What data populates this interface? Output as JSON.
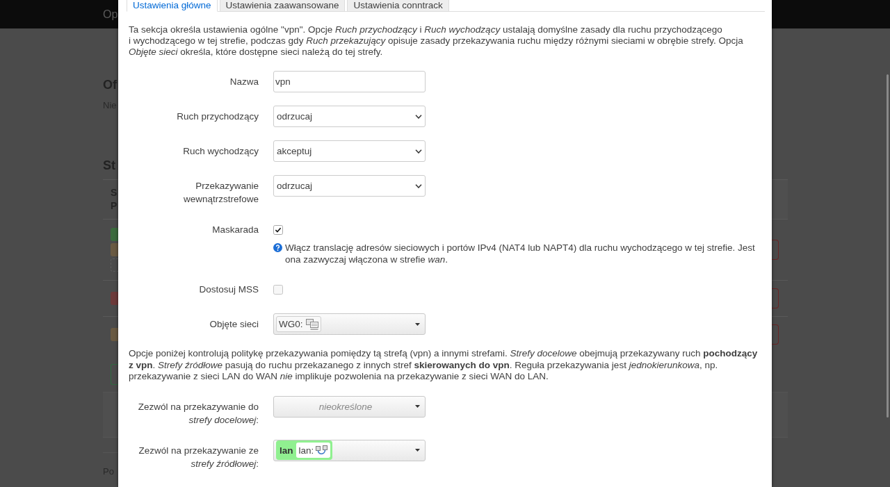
{
  "background_page": {
    "header_title": "Op",
    "heading": "Of",
    "subtitle": "Nie",
    "section_heading": "St",
    "table": {
      "header": [
        "S",
        "P"
      ],
      "rows": [
        {
          "badges": [
            {
              "kind": "solid",
              "color": "#3b6a3d"
            },
            {
              "kind": "solid",
              "color": "#6a5a42"
            },
            {
              "kind": "dashed",
              "color": "#5e5e5e"
            }
          ]
        },
        {
          "badges": [
            {
              "kind": "solid",
              "color": "#6d3a3a"
            }
          ]
        },
        {
          "badges": [
            {
              "kind": "solid",
              "color": "#6a5a42"
            }
          ]
        }
      ]
    },
    "footer_text": "Po"
  },
  "modal": {
    "tabs": [
      {
        "label": "Ustawienia główne",
        "selected": true
      },
      {
        "label": "Ustawienia zaawansowane",
        "selected": false
      },
      {
        "label": "Ustawienia conntrack",
        "selected": false
      }
    ],
    "intro": "Ta sekcja określa ustawienia ogólne \"vpn\". Opcje *Ruch przychodzący* i *Ruch wychodzący* ustalają domyślne zasady dla ruchu przychodzącego i wychodzącego w tej strefie, podczas gdy *Ruch przekazujący* opisuje zasady przekazywania ruchu między różnymi sieciami w obrębie strefy. Opcja *Objęte sieci* określa, które dostępne sieci należą do tej strefy.",
    "fields": [
      {
        "kind": "text",
        "label": "Nazwa",
        "value": "vpn"
      },
      {
        "kind": "select",
        "label": "Ruch przychodzący",
        "value": "odrzucaj"
      },
      {
        "kind": "select",
        "label": "Ruch wychodzący",
        "value": "akceptuj"
      },
      {
        "kind": "select",
        "label": "Przekazywanie wewnątrzstrefowe",
        "value": "odrzucaj"
      },
      {
        "kind": "checkbox",
        "label": "Maskarada",
        "checked": true,
        "help": "Włącz translację adresów sieciowych i portów IPv4 (NAT4 lub NAPT4) dla ruchu wychodzącego w tej strefie. Jest ona zazwyczaj włączona w strefie *wan*."
      },
      {
        "kind": "checkbox",
        "label": "Dostosuj MSS",
        "checked": false
      },
      {
        "kind": "network_picker",
        "label": "Objęte sieci",
        "chips": [
          {
            "name": "WG0:"
          }
        ]
      }
    ],
    "forwarding_note": "Opcje poniżej kontrolują politykę przekazywania pomiędzy tą strefą (vpn) a innymi strefami. *Strefy docelowe* obejmują przekazywany ruch **pochodzący z vpn**. *Strefy źródłowe* pasują do ruchu przekazanego z innych stref **skierowanych do vpn**. Reguła przekazywania jest *jednokierunkowa*, np. przekazywanie z sieci LAN do WAN *nie* implikuje pozwolenia na przekazywanie z sieci WAN do LAN.",
    "forwarding_fields": [
      {
        "kind": "zone_picker",
        "label": "Zezwól na przekazywanie do *strefy docelowej*:",
        "placeholder": "nieokreślone"
      },
      {
        "kind": "zone_picker",
        "label": "Zezwól na przekazywanie ze *strefy źródłowej*:",
        "zones": [
          {
            "zone": "lan",
            "network": "lan:",
            "color": "#90f090"
          }
        ]
      }
    ]
  }
}
